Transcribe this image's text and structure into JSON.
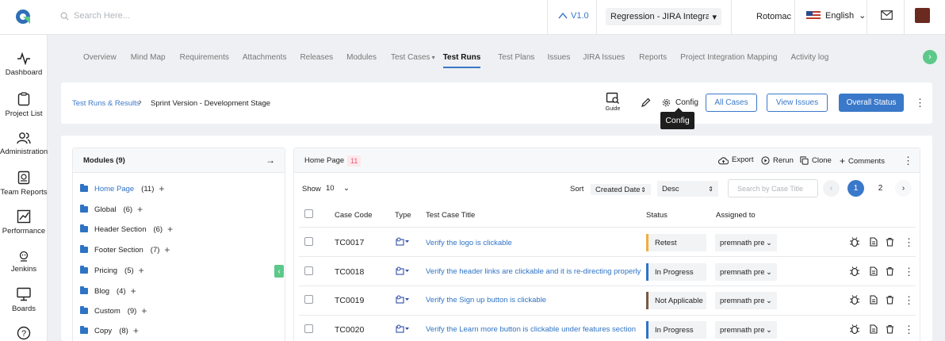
{
  "topbar": {
    "search_placeholder": "Search Here...",
    "version": "V1.0",
    "project": "Regression - JIRA Integration",
    "user": "Rotomac",
    "language": "English"
  },
  "sidebar": {
    "items": [
      {
        "label": "Dashboard",
        "icon": "pulse-icon"
      },
      {
        "label": "Project List",
        "icon": "clipboard-icon"
      },
      {
        "label": "Administration",
        "icon": "users-icon"
      },
      {
        "label": "Team Reports",
        "icon": "report-icon"
      },
      {
        "label": "Performance",
        "icon": "chart-icon"
      },
      {
        "label": "Jenkins",
        "icon": "jenkins-icon"
      },
      {
        "label": "Boards",
        "icon": "monitor-icon"
      }
    ]
  },
  "tabs": [
    "Overview",
    "Mind Map",
    "Requirements",
    "Attachments",
    "Releases",
    "Modules",
    "Test Cases",
    "Test Runs",
    "Test Plans",
    "Issues",
    "JIRA Issues",
    "Reports",
    "Project Integration Mapping",
    "Activity log"
  ],
  "active_tab": "Test Runs",
  "header": {
    "breadcrumb_link": "Test Runs & Results",
    "breadcrumb_current": "Sprint Version - Development Stage",
    "guide": "Guide",
    "config": "Config",
    "tooltip": "Config",
    "all_cases": "All Cases",
    "view_issues": "View Issues",
    "overall_status": "Overall Status"
  },
  "modules": {
    "title": "Modules (9)",
    "items": [
      {
        "name": "Home Page",
        "count": "(11)",
        "active": true
      },
      {
        "name": "Global",
        "count": "(6)"
      },
      {
        "name": "Header Section",
        "count": "(6)"
      },
      {
        "name": "Footer Section",
        "count": "(7)"
      },
      {
        "name": "Pricing",
        "count": "(5)"
      },
      {
        "name": "Blog",
        "count": "(4)"
      },
      {
        "name": "Custom",
        "count": "(9)"
      },
      {
        "name": "Copy",
        "count": "(8)"
      }
    ]
  },
  "cases": {
    "title": "Home Page",
    "count": "11",
    "export": "Export",
    "rerun": "Rerun",
    "clone": "Clone",
    "comments": "Comments",
    "show_label": "Show",
    "show_value": "10",
    "sort_label": "Sort",
    "sort_by": "Created Date",
    "sort_order": "Desc",
    "search_placeholder": "Search by Case Title",
    "pages": [
      "1",
      "2"
    ],
    "current_page": "1",
    "columns": {
      "code": "Case Code",
      "type": "Type",
      "title": "Test Case Title",
      "status": "Status",
      "assigned": "Assigned to"
    },
    "rows": [
      {
        "code": "TC0017",
        "title": "Verify the logo is clickable",
        "status": "Retest",
        "status_color": "#f0ad3c",
        "assignee": "premnath prem"
      },
      {
        "code": "TC0018",
        "title": "Verify the header links are clickable and it is re-directing properly",
        "status": "In Progress",
        "status_color": "#2f73c4",
        "assignee": "premnath prem"
      },
      {
        "code": "TC0019",
        "title": "Verify the Sign up button is clickable",
        "status": "Not Applicable",
        "status_color": "#7a5a44",
        "assignee": "premnath prem"
      },
      {
        "code": "TC0020",
        "title": "Verify the Learn more button is clickable under features section",
        "status": "In Progress",
        "status_color": "#2f73c4",
        "assignee": "premnath prem"
      }
    ]
  },
  "colors": {
    "accent": "#3a78c9",
    "success": "#5cc88a",
    "badge": "#e05a70"
  }
}
